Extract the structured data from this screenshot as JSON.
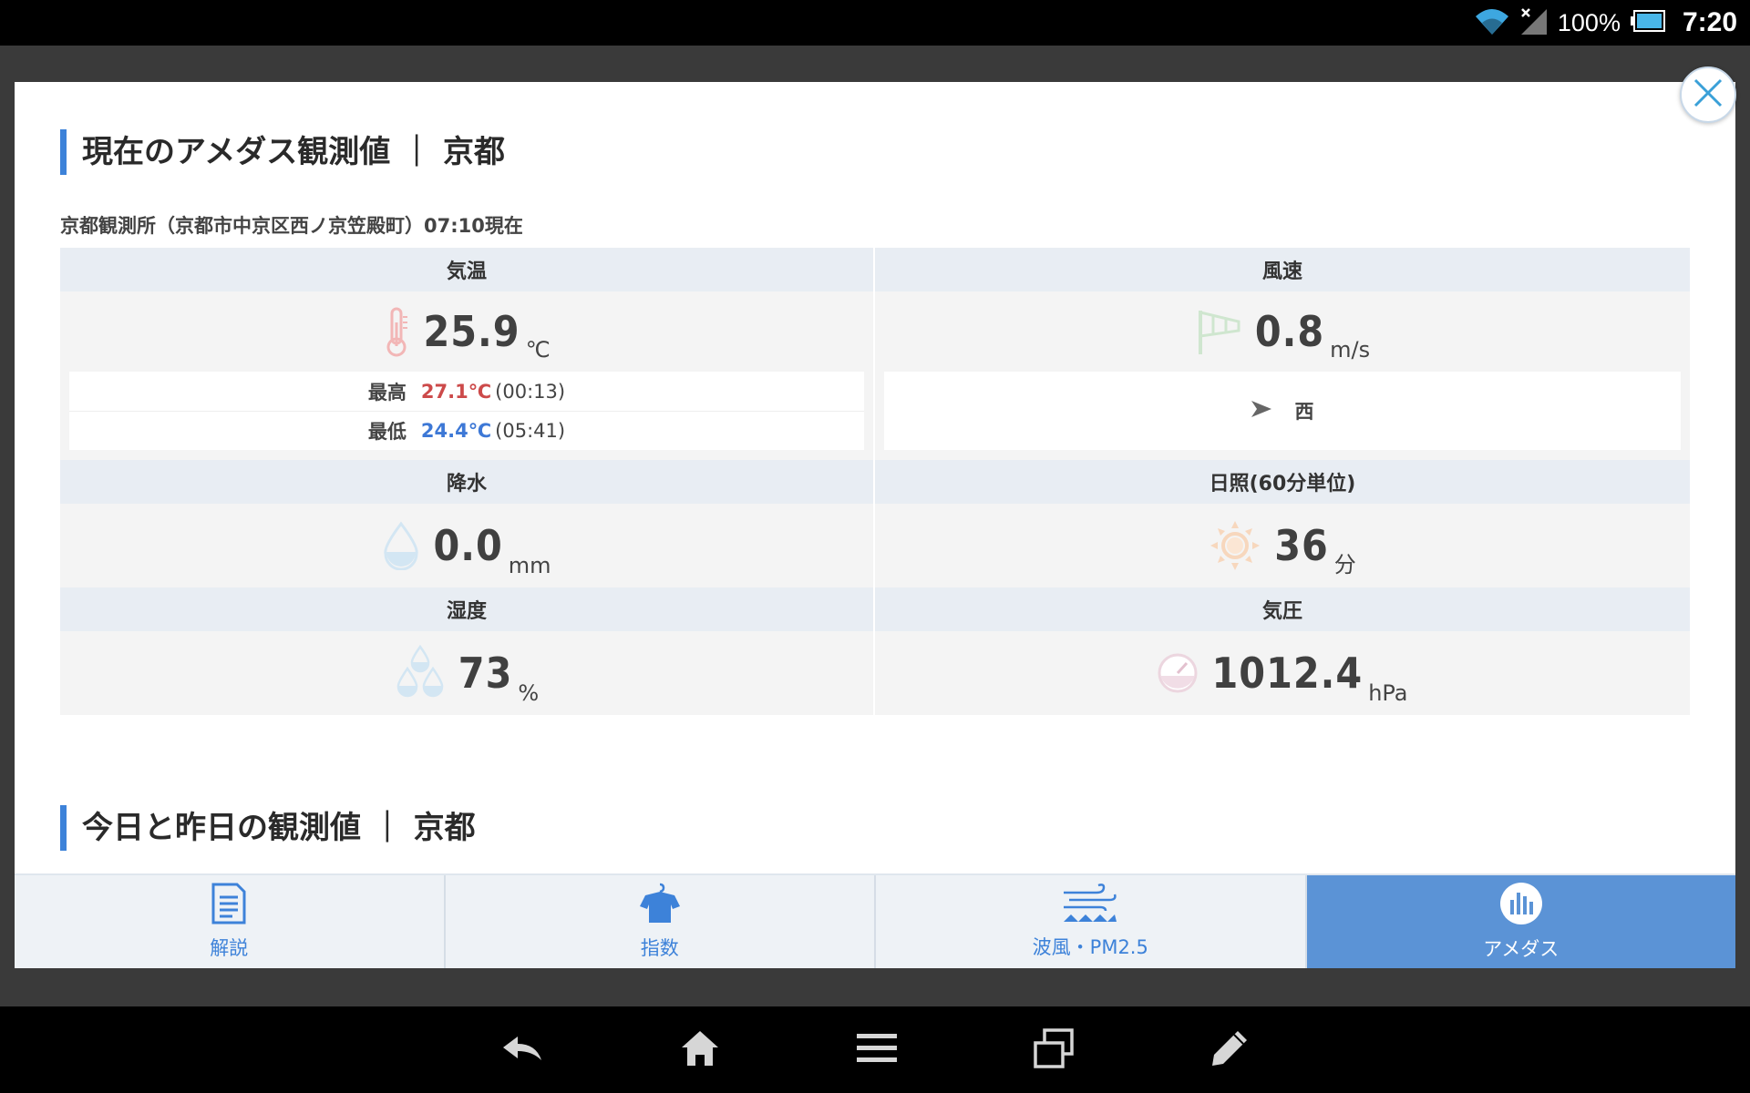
{
  "status_bar": {
    "battery": "100%",
    "time": "7:20"
  },
  "current": {
    "title": "現在のアメダス観測値 ｜ 京都",
    "station": "京都観測所（京都市中京区西ノ京笠殿町）07:10現在",
    "temperature": {
      "label": "気温",
      "value": "25.9",
      "unit": "℃",
      "max_label": "最高",
      "max_value": "27.1℃",
      "max_time": "(00:13)",
      "min_label": "最低",
      "min_value": "24.4℃",
      "min_time": "(05:41)"
    },
    "wind": {
      "label": "風速",
      "value": "0.8",
      "unit": "m/s",
      "direction": "西"
    },
    "precipitation": {
      "label": "降水",
      "value": "0.0",
      "unit": "mm"
    },
    "sunshine": {
      "label": "日照(60分単位)",
      "value": "36",
      "unit": "分"
    },
    "humidity": {
      "label": "湿度",
      "value": "73",
      "unit": "%"
    },
    "pressure": {
      "label": "気圧",
      "value": "1012.4",
      "unit": "hPa"
    }
  },
  "history": {
    "title": "今日と昨日の観測値 ｜ 京都"
  },
  "tabs": [
    {
      "label": "解説",
      "icon": "document-icon",
      "active": false
    },
    {
      "label": "指数",
      "icon": "shirt-icon",
      "active": false
    },
    {
      "label": "波風・PM2.5",
      "icon": "wind-wave-icon",
      "active": false
    },
    {
      "label": "アメダス",
      "icon": "bar-chart-icon",
      "active": true
    }
  ],
  "colors": {
    "accent": "#3d82d9",
    "active_tab": "#5b93d6",
    "max_temp": "#cc4a4a",
    "min_temp": "#3d78d6"
  }
}
